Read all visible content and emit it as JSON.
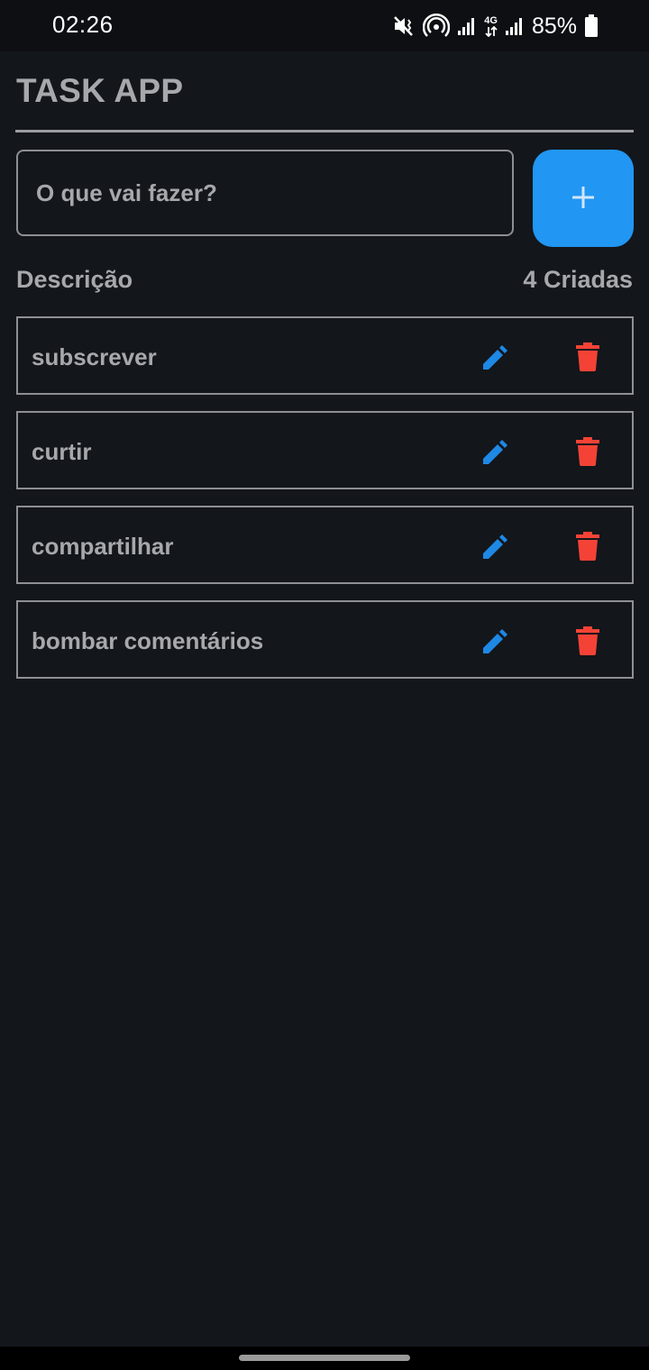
{
  "status_bar": {
    "time": "02:26",
    "network_label": "4G",
    "battery_percent": "85%",
    "icons": [
      "vibrate-mute-icon",
      "hotspot-icon",
      "signal-icon",
      "network-4g-icon",
      "signal-icon",
      "battery-icon"
    ]
  },
  "app": {
    "title": "TASK APP"
  },
  "input": {
    "placeholder": "O que vai fazer?",
    "value": ""
  },
  "add_button": {
    "icon": "plus-icon",
    "color": "#2196f3"
  },
  "list_header": {
    "left": "Descrição",
    "right": "4 Criadas"
  },
  "tasks": [
    {
      "label": "subscrever"
    },
    {
      "label": "curtir"
    },
    {
      "label": "compartilhar"
    },
    {
      "label": "bombar comentários"
    }
  ],
  "colors": {
    "background": "#13161b",
    "text": "#a6a8ab",
    "edit_icon": "#1e88e5",
    "delete_icon": "#f44336"
  }
}
